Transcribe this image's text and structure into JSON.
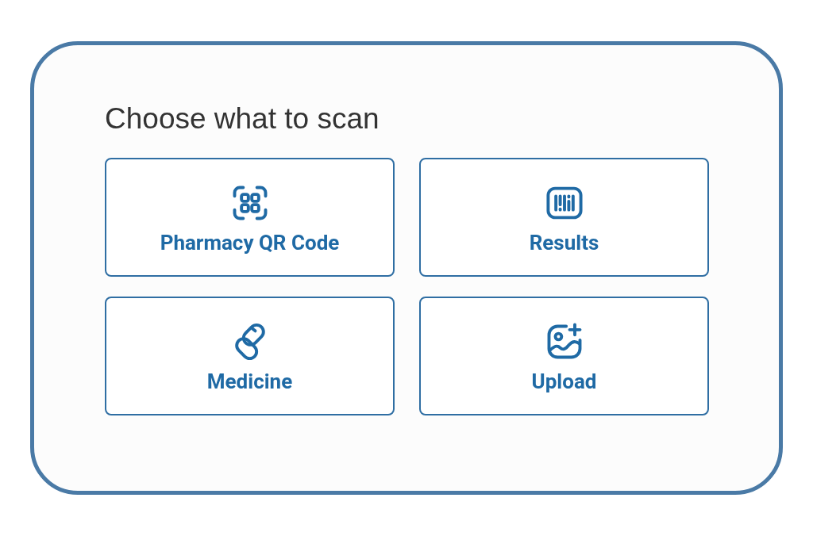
{
  "title": "Choose what to scan",
  "options": [
    {
      "kind": "qr",
      "label": "Pharmacy QR Code"
    },
    {
      "kind": "barcode",
      "label": "Results"
    },
    {
      "kind": "pill",
      "label": "Medicine"
    },
    {
      "kind": "image-add",
      "label": "Upload"
    }
  ]
}
